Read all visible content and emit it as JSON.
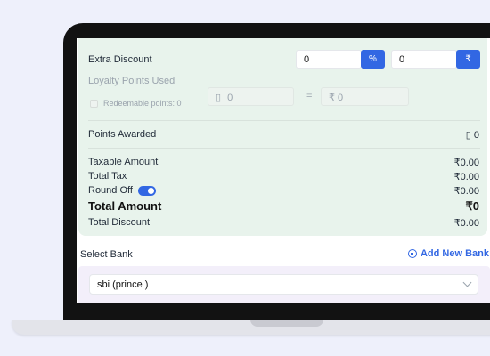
{
  "summary": {
    "extra_discount_label": "Extra Discount",
    "percent_value": "0",
    "percent_symbol": "%",
    "amount_value": "0",
    "rupee_symbol": "₹",
    "loyalty_label": "Loyalty Points Used",
    "redeemable_label": "Redeemable points: 0",
    "points_input_value": "0",
    "equals": "=",
    "rupee_input_value": "₹  0",
    "points_awarded_label": "Points Awarded",
    "points_awarded_value": "0",
    "taxable_label": "Taxable Amount",
    "taxable_value": "₹0.00",
    "tax_label": "Total Tax",
    "tax_value": "₹0.00",
    "round_off_label": "Round Off",
    "round_off_enabled": true,
    "round_off_value": "₹0.00",
    "total_label": "Total Amount",
    "total_value": "₹0",
    "total_discount_label": "Total Discount",
    "total_discount_value": "₹0.00"
  },
  "bank": {
    "label": "Select Bank",
    "add_label": "Add New Bank",
    "selected": "sbi (prince )"
  },
  "colors": {
    "accent": "#3267e3",
    "panel": "#e8f3ec",
    "bank_area": "#f3effa"
  }
}
